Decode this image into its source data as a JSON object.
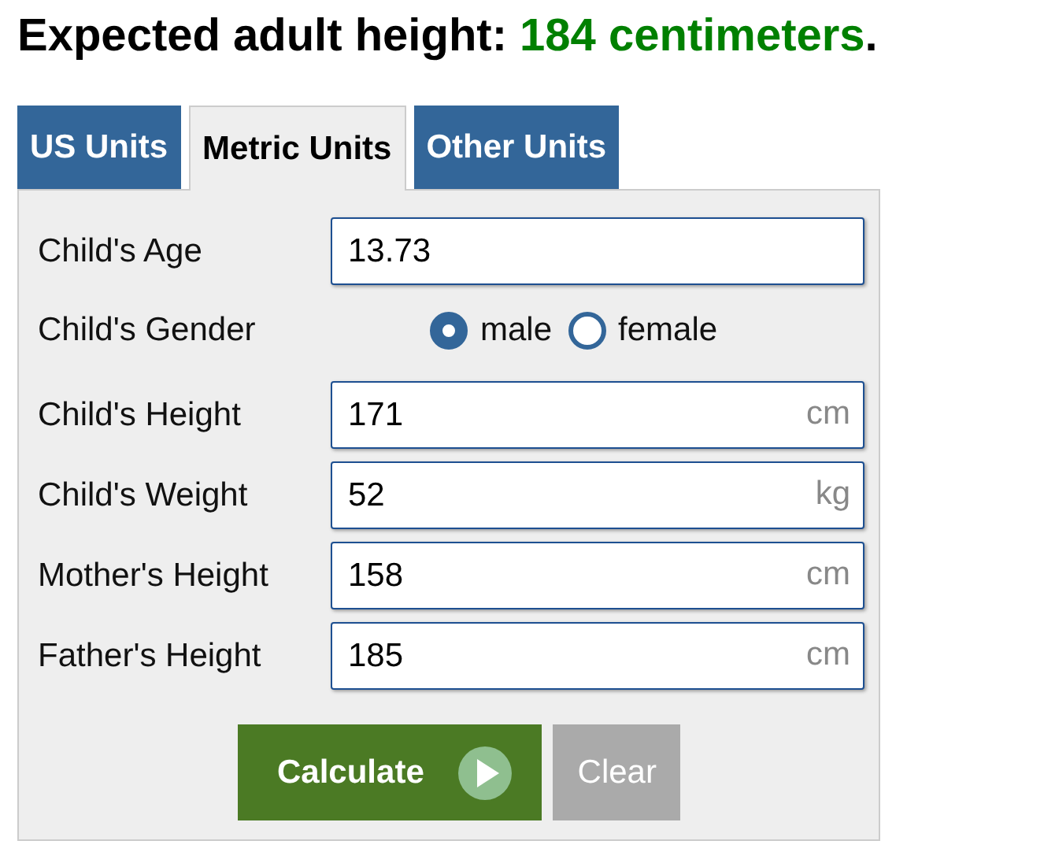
{
  "heading": {
    "label": "Expected adult height: ",
    "value": "184 centimeters",
    "suffix": "."
  },
  "tabs": [
    {
      "label": "US Units",
      "selected": false
    },
    {
      "label": "Metric Units",
      "selected": true
    },
    {
      "label": "Other Units",
      "selected": false
    }
  ],
  "fields": [
    {
      "kind": "text",
      "label": "Child's Age",
      "value": "13.73"
    },
    {
      "kind": "radio",
      "label": "Child's Gender",
      "options": [
        {
          "label": "male",
          "selected": true
        },
        {
          "label": "female",
          "selected": false
        }
      ]
    },
    {
      "kind": "text",
      "label": "Child's Height",
      "value": "171",
      "unit": "cm"
    },
    {
      "kind": "text",
      "label": "Child's Weight",
      "value": "52",
      "unit": "kg"
    },
    {
      "kind": "text",
      "label": "Mother's Height",
      "value": "158",
      "unit": "cm"
    },
    {
      "kind": "text",
      "label": "Father's Height",
      "value": "185",
      "unit": "cm"
    }
  ],
  "buttons": {
    "calculate": "Calculate",
    "clear": "Clear"
  }
}
